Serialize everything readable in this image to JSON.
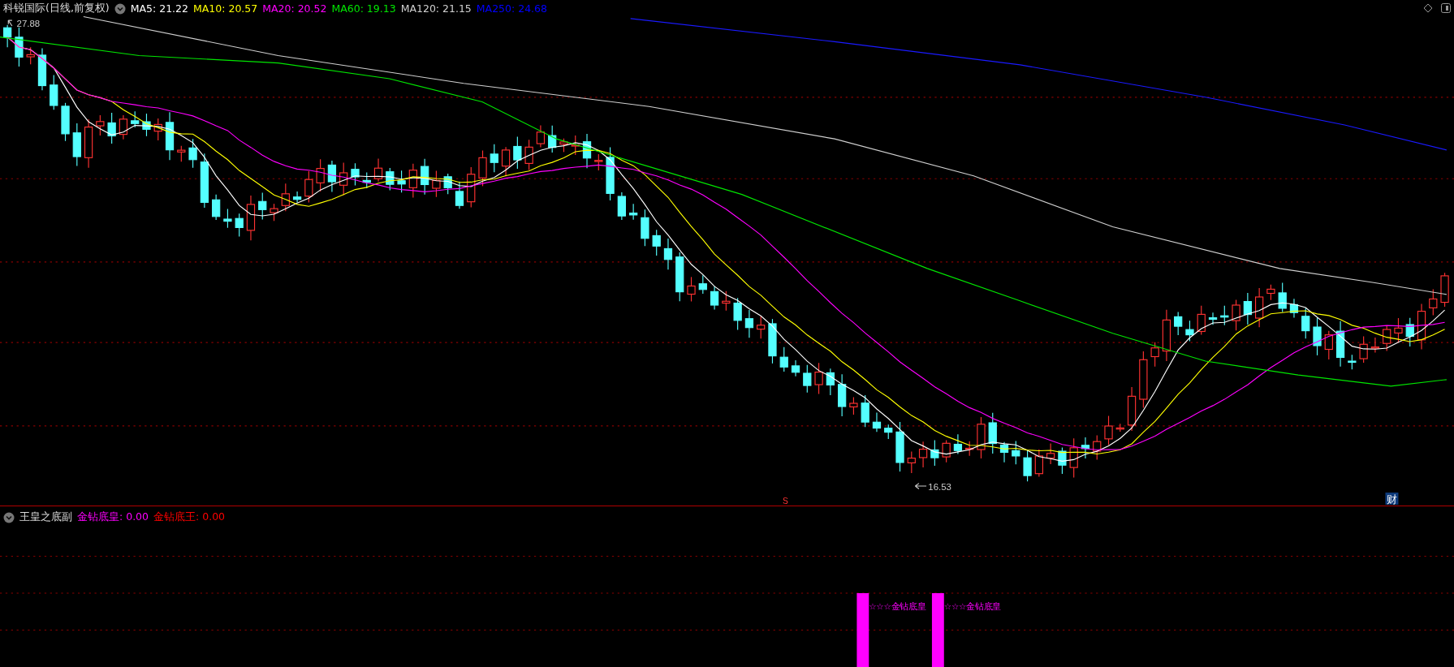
{
  "title": "科锐国际(日线,前复权)",
  "indicators": [
    {
      "label": "MA5: 21.22",
      "color": "#ffffff"
    },
    {
      "label": "MA10: 20.57",
      "color": "#ffff00"
    },
    {
      "label": "MA20: 20.52",
      "color": "#ff00ff"
    },
    {
      "label": "MA60: 19.13",
      "color": "#00e600"
    },
    {
      "label": "MA120: 21.15",
      "color": "#d0d0d0"
    },
    {
      "label": "MA250: 24.68",
      "color": "#0000ff"
    }
  ],
  "chart_marks": {
    "high": "27.88",
    "low": "16.53",
    "signal": "S",
    "finance": "财"
  },
  "sub_panel": {
    "title": "王皇之底副",
    "indicators": [
      {
        "label": "金钻底皇: 0.00",
        "color": "#ff00ff"
      },
      {
        "label": "金钻底王: 0.00",
        "color": "#ff0000"
      }
    ],
    "signals": [
      {
        "label": "☆☆☆金钻底皇"
      },
      {
        "label": "☆☆☆金钻底皇"
      }
    ]
  }
}
